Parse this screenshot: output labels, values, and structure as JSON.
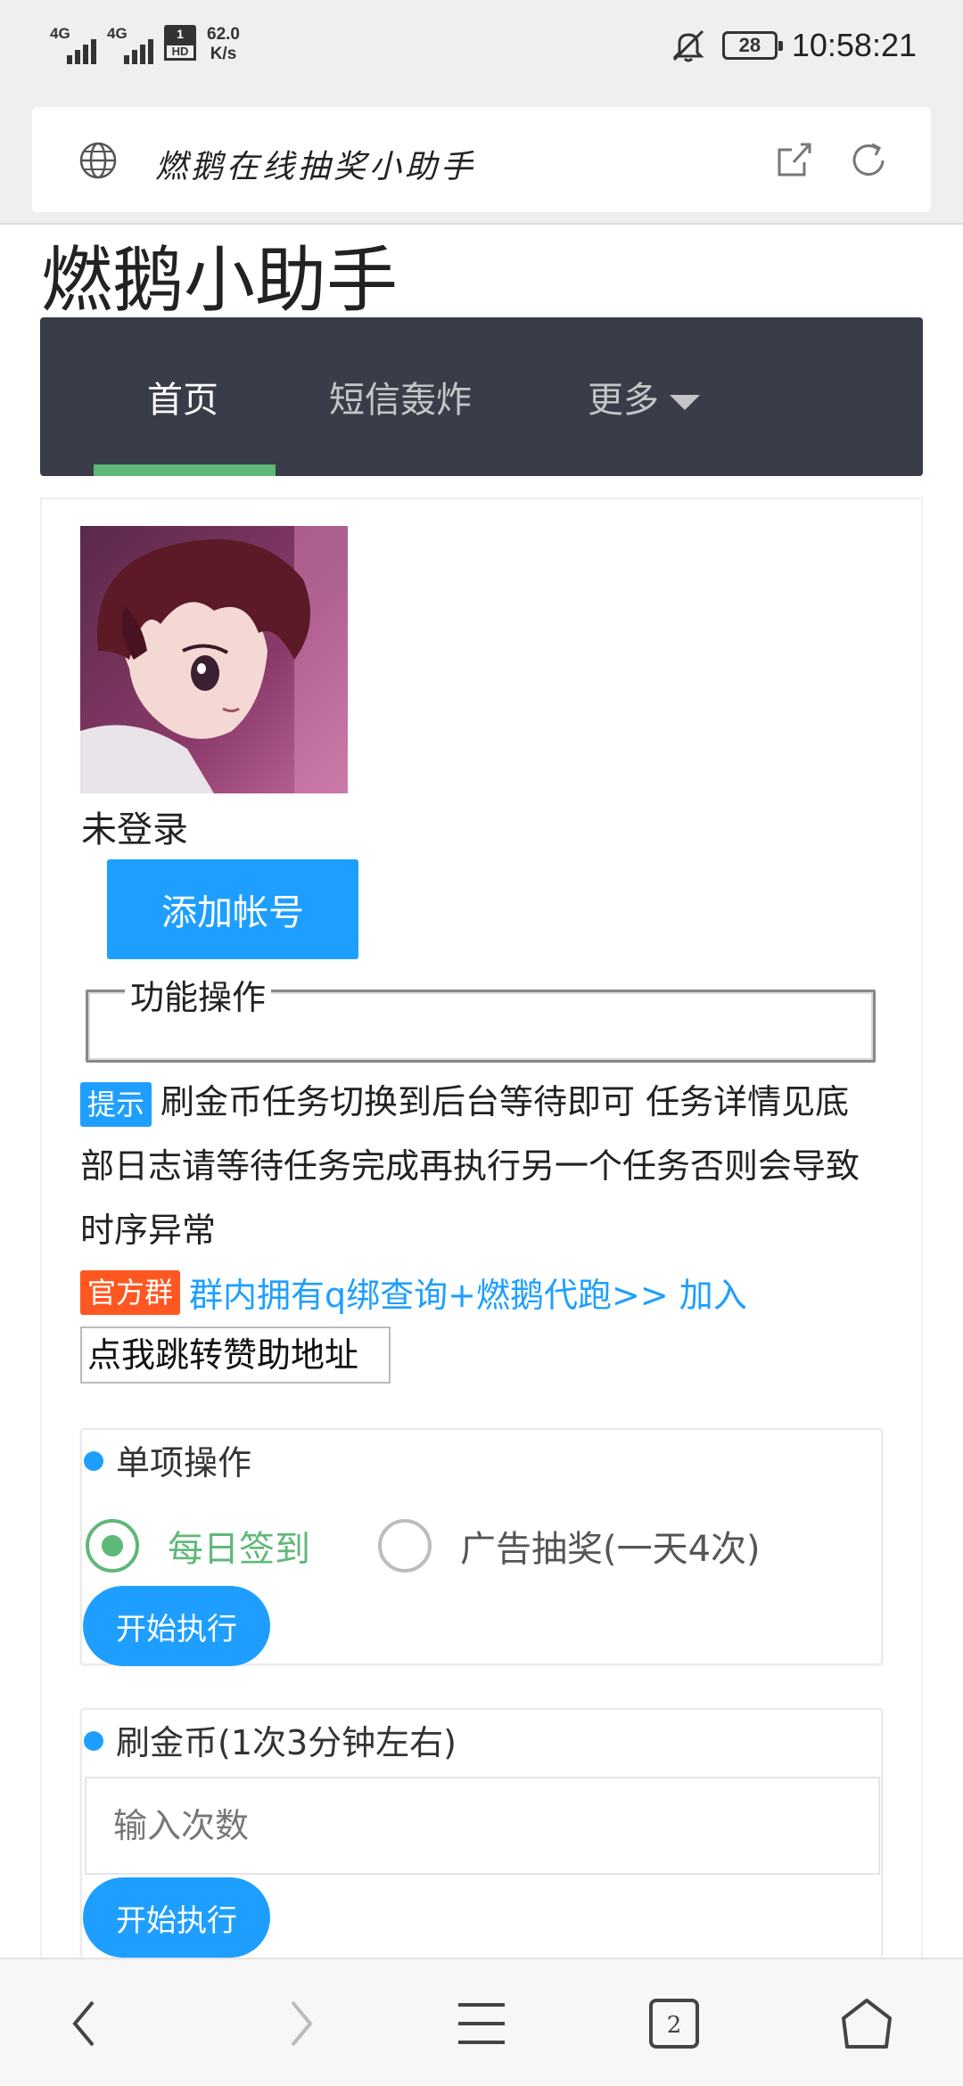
{
  "status_bar": {
    "signal1_label": "4G",
    "signal2_label": "4G",
    "hd_top": "1",
    "hd_bottom": "HD",
    "speed_value": "62.0",
    "speed_unit": "K/s",
    "battery": "28",
    "time": "10:58:21"
  },
  "browser": {
    "page_title": "燃鹅在线抽奖小助手",
    "tab_count": "2"
  },
  "site": {
    "title": "燃鹅小助手",
    "nav": [
      {
        "label": "首页",
        "active": true
      },
      {
        "label": "短信轰炸",
        "active": false
      },
      {
        "label": "更多",
        "active": false
      }
    ]
  },
  "account": {
    "status": "未登录",
    "add_button": "添加帐号"
  },
  "operations": {
    "legend": "功能操作",
    "tip_tag": "提示",
    "tip_text": "刷金币任务切换到后台等待即可 任务详情见底部日志请等待任务完成再执行另一个任务否则会导致时序异常",
    "group_tag": "官方群",
    "group_text": "群内拥有q绑查询+燃鹅代跑>> 加入",
    "sponsor_button": "点我跳转赞助地址"
  },
  "single_op": {
    "title": "单项操作",
    "options": [
      {
        "label": "每日签到",
        "checked": true
      },
      {
        "label": "广告抽奖(一天4次)",
        "checked": false
      }
    ],
    "run_button": "开始执行"
  },
  "coin_op": {
    "title": "刷金币(1次3分钟左右)",
    "input_placeholder": "输入次数",
    "run_button": "开始执行"
  },
  "colors": {
    "accent_blue": "#1e9fff",
    "nav_bg": "#393d49",
    "nav_indicator": "#5fb878",
    "tag_orange": "#ff5722"
  }
}
